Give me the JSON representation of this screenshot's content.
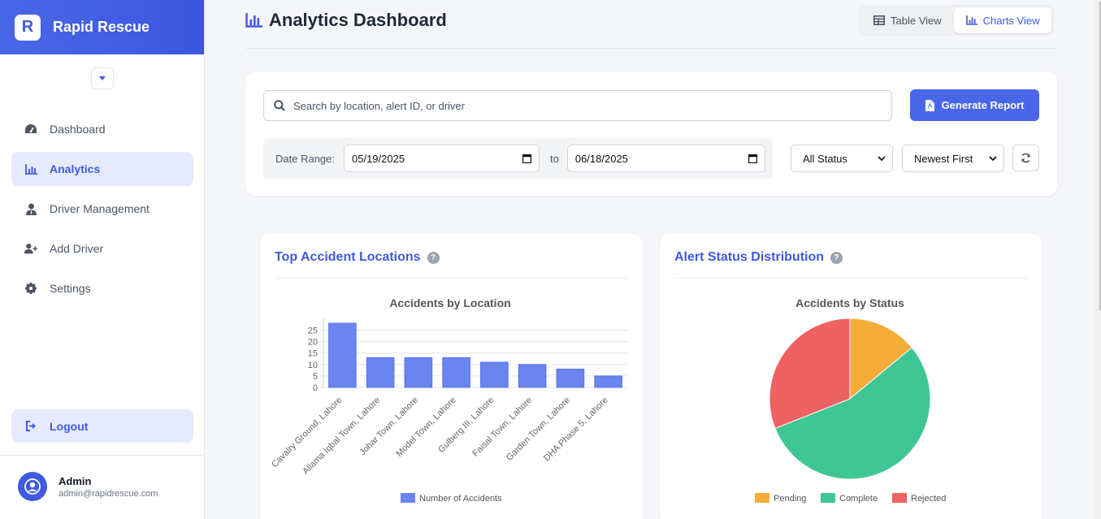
{
  "app": {
    "name": "Rapid Rescue",
    "logo_letter": "R",
    "accent": "#4a66e8"
  },
  "sidebar": {
    "items": [
      {
        "label": "Dashboard",
        "icon": "gauge-icon",
        "active": false
      },
      {
        "label": "Analytics",
        "icon": "chart-bar-icon",
        "active": true
      },
      {
        "label": "Driver Management",
        "icon": "user-tie-icon",
        "active": false
      },
      {
        "label": "Add Driver",
        "icon": "user-plus-icon",
        "active": false
      },
      {
        "label": "Settings",
        "icon": "gear-icon",
        "active": false
      }
    ],
    "logout_label": "Logout",
    "user": {
      "name": "Admin",
      "email": "admin@rapidrescue.com"
    }
  },
  "header": {
    "title": "Analytics Dashboard",
    "views": [
      {
        "label": "Table View",
        "active": false
      },
      {
        "label": "Charts View",
        "active": true
      }
    ]
  },
  "filters": {
    "search_placeholder": "Search by location, alert ID, or driver",
    "report_label": "Generate Report",
    "date_range_label": "Date Range:",
    "to_label": "to",
    "date_from": "05/19/2025",
    "date_to": "06/18/2025",
    "status_value": "All Status",
    "sort_value": "Newest First"
  },
  "cards": {
    "locations_title": "Top Accident Locations",
    "status_title": "Alert Status Distribution"
  },
  "chart_data": [
    {
      "type": "bar",
      "title": "Accidents by Location",
      "categories": [
        "Cavalry Ground, Lahore",
        "Allama Iqbal Town, Lahore",
        "Johar Town, Lahore",
        "Model Town, Lahore",
        "Gulberg III, Lahore",
        "Faisal Town, Lahore",
        "Garden Town, Lahore",
        "DHA Phase 5, Lahore"
      ],
      "series": [
        {
          "name": "Number of Accidents",
          "values": [
            28,
            13,
            13,
            13,
            11,
            10,
            8,
            5
          ],
          "color": "#6a84f0"
        }
      ],
      "yticks": [
        0,
        5,
        10,
        15,
        20,
        25
      ],
      "ylim": [
        0,
        28
      ],
      "grid": true,
      "legend": "bottom"
    },
    {
      "type": "pie",
      "title": "Accidents by Status",
      "categories": [
        "Pending",
        "Complete",
        "Rejected"
      ],
      "values": [
        14,
        55,
        31
      ],
      "colors": [
        "#f5ac38",
        "#3ec795",
        "#ef6262"
      ],
      "legend": "bottom"
    }
  ]
}
